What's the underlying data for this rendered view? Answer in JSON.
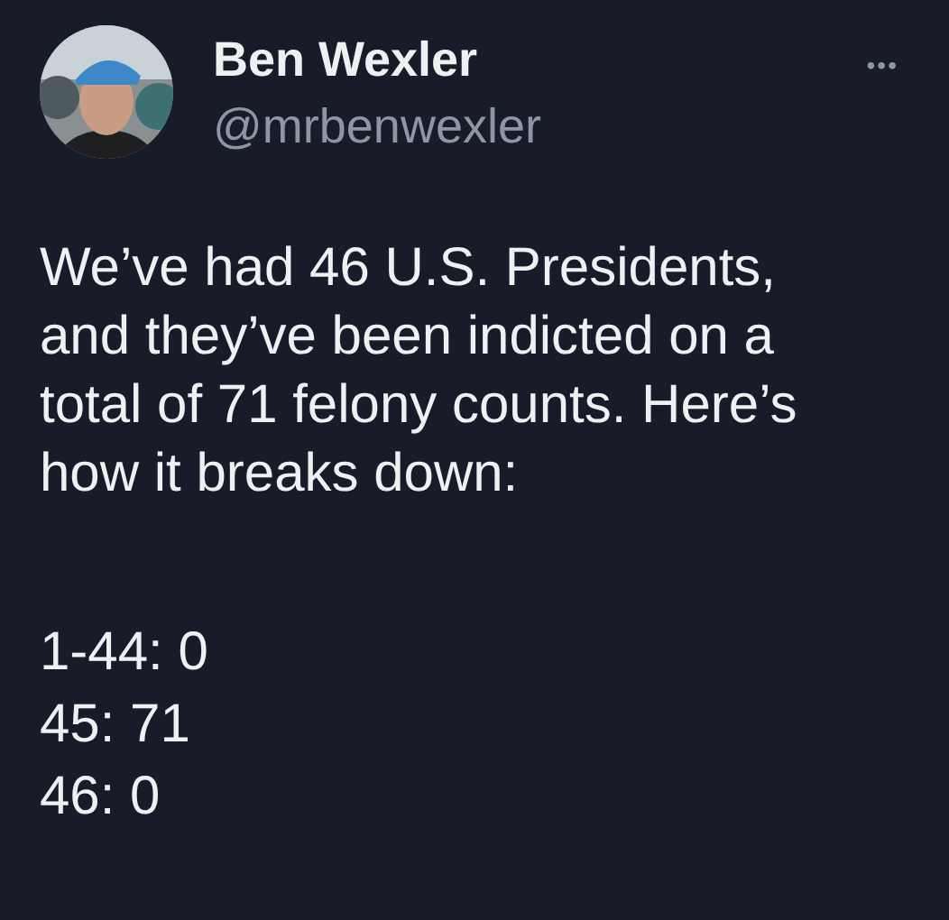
{
  "tweet": {
    "author": {
      "name": "Ben Wexler",
      "handle": "@mrbenwexler"
    },
    "more_button": "•••",
    "text": "We’ve had 46 U.S. Presidents,\nand they’ve been indicted on a\ntotal of 71 felony counts. Here’s\nhow it breaks down:",
    "breakdown": [
      "1-44: 0",
      "45: 71",
      "46: 0"
    ]
  }
}
